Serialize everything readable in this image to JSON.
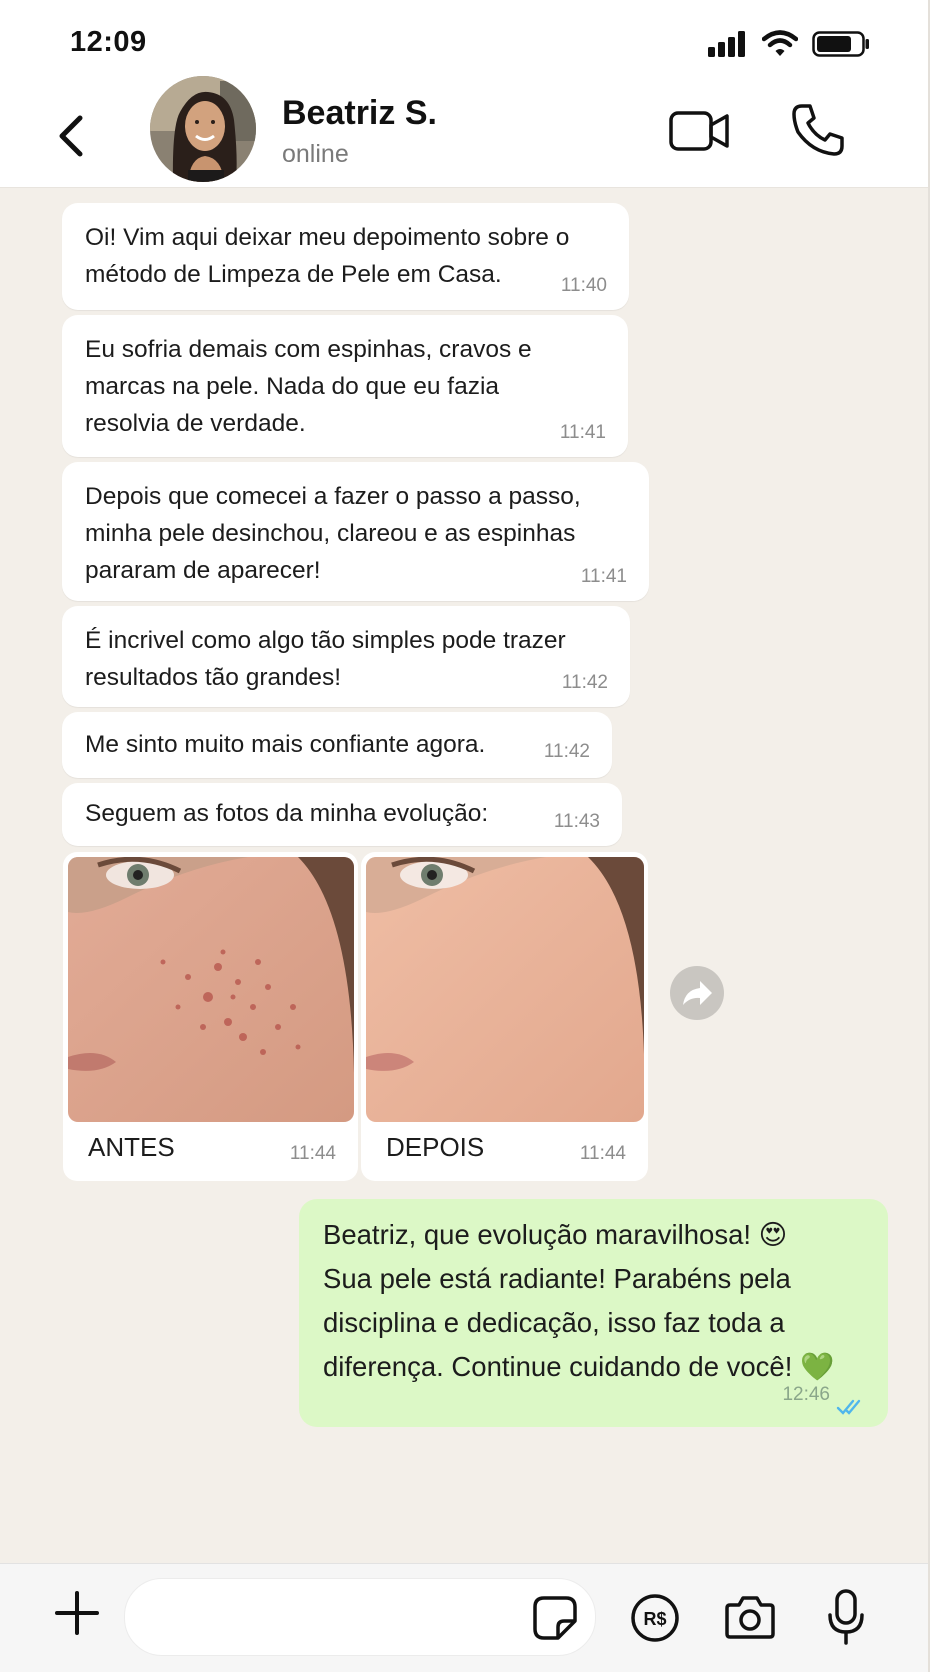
{
  "status": {
    "time": "12:09"
  },
  "contact": {
    "name": "Beatriz S.",
    "presence": "online"
  },
  "messages": [
    {
      "text": "Oi! Vim aqui deixar meu depoimento sobre o\nmétodo de Limpeza de Pele em Casa.",
      "time": "11:40"
    },
    {
      "text": "Eu sofria demais com espinhas, cravos e\nmarcas na pele. Nada do que eu fazia\nresolvia de verdade.",
      "time": "11:41"
    },
    {
      "text": "Depois que comecei a fazer o passo a passo,\nminha pele desinchou, clareou e as espinhas\npararam de aparecer!",
      "time": "11:41"
    },
    {
      "text": "É incrivel como algo tão simples pode trazer\nresultados tão grandes!",
      "time": "11:42"
    },
    {
      "text": "Me sinto muito mais confiante agora.",
      "time": "11:42"
    },
    {
      "text": "Seguem as fotos da minha evolução:",
      "time": "11:43"
    }
  ],
  "images": [
    {
      "caption": "ANTES",
      "time": "11:44"
    },
    {
      "caption": "DEPOIS",
      "time": "11:44"
    }
  ],
  "reply": {
    "text": "Beatriz, que evolução maravilhosa! 😍\nSua pele está radiante! Parabéns pela\ndisciplina e dedicação, isso faz toda a\ndiferença. Continue cuidando de você! 💚",
    "time": "12:46"
  },
  "colors": {
    "outgoing_bubble": "#dcf8c6",
    "chat_bg": "#f3efe9",
    "read_ticks": "#4fb6ec"
  },
  "icons": [
    "back-icon",
    "video-call-icon",
    "phone-icon",
    "forward-icon",
    "plus-icon",
    "sticker-icon",
    "payment-icon",
    "camera-icon",
    "microphone-icon"
  ]
}
